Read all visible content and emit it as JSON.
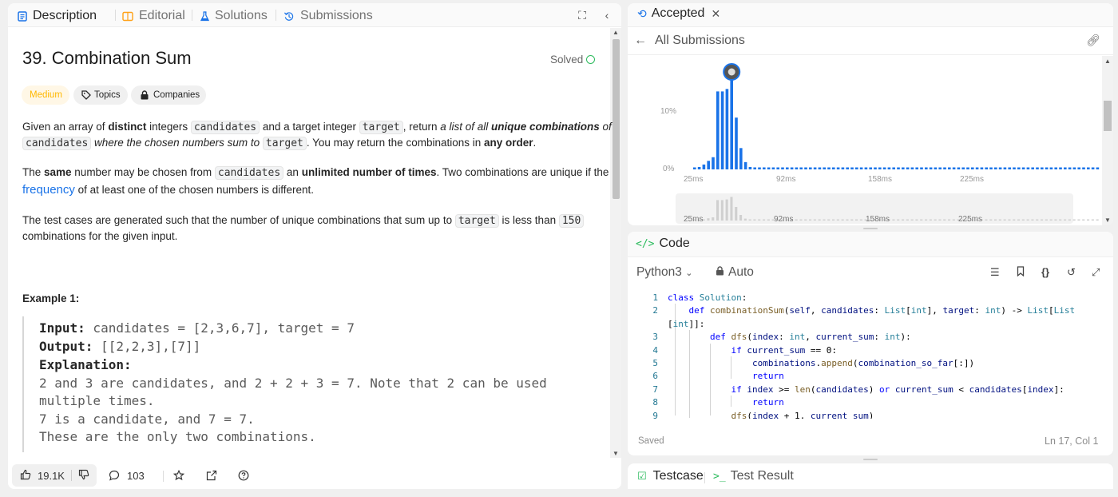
{
  "left_tabs": [
    {
      "label": "Description",
      "icon": "description-icon"
    },
    {
      "label": "Editorial",
      "icon": "editorial-icon"
    },
    {
      "label": "Solutions",
      "icon": "flask-icon"
    },
    {
      "label": "Submissions",
      "icon": "history-icon"
    }
  ],
  "problem": {
    "title": "39. Combination Sum",
    "status": "Solved",
    "difficulty": "Medium",
    "topics_label": "Topics",
    "companies_label": "Companies"
  },
  "description": {
    "p1a": "Given an array of ",
    "p1_distinct": "distinct",
    "p1b": " integers ",
    "p1_code1": "candidates",
    "p1c": " and a target integer ",
    "p1_code2": "target",
    "p1d": ", return ",
    "p1_ital1": "a list of all ",
    "p1_bolditl": "unique combinations",
    "p1_ital2": " of",
    "p2_code": "candidates",
    "p2_ital": " where the chosen numbers sum to ",
    "p2_code2": "target",
    "p2b": ". You may return the combinations in ",
    "p2_bold": "any order",
    "p2c": ".",
    "p3a": "The ",
    "p3_same": "same",
    "p3b": " number may be chosen from ",
    "p3_code": "candidates",
    "p3c": " an ",
    "p3_unl": "unlimited number of times",
    "p3d": ". Two combinations are unique if the",
    "p4_link": "frequency",
    "p4b": " of at least one of the chosen numbers is different.",
    "p5a": "The test cases are generated such that the number of unique combinations that sum up to ",
    "p5_code": "target",
    "p5b": " is less than ",
    "p5_code2": "150",
    "p6": "combinations for the given input."
  },
  "example": {
    "title": "Example 1:",
    "input_label": "Input:",
    "input_value": " candidates = [2,3,6,7], target = 7",
    "output_label": "Output:",
    "output_value": " [[2,2,3],[7]]",
    "explanation_label": "Explanation:",
    "lines": [
      "2 and 3 are candidates, and 2 + 2 + 3 = 7. Note that 2 can be used",
      "multiple times.",
      "7 is a candidate, and 7 = 7.",
      "These are the only two combinations."
    ]
  },
  "bottom_bar": {
    "likes": "19.1K",
    "comments": "103"
  },
  "submission": {
    "tab_label": "Accepted",
    "back_label": "All Submissions"
  },
  "chart_data": {
    "type": "bar",
    "ylabels": [
      "10%",
      "0%"
    ],
    "xticks": [
      "25ms",
      "92ms",
      "158ms",
      "225ms"
    ],
    "values": [
      0.3,
      0.4,
      0.8,
      1.4,
      2.0,
      12.8,
      12.8,
      13.2,
      14.8,
      8.5,
      3.5,
      1.2,
      0.4,
      0.3,
      0.2,
      0.2,
      0.2,
      0.15,
      0.15,
      0.15,
      0.15,
      0.15,
      0.15,
      0.15,
      0.15,
      0.15,
      0.15,
      0.15,
      0.15,
      0.15,
      0.15,
      0.15,
      0.15,
      0.15,
      0.15,
      0.15,
      0.15,
      0.15,
      0.15,
      0.15,
      0.15,
      0.15,
      0.15,
      0.15,
      0.15,
      0.15,
      0.15,
      0.15,
      0.15,
      0.15,
      0.15,
      0.15,
      0.15,
      0.15,
      0.15,
      0.15,
      0.15,
      0.15,
      0.15,
      0.15,
      0.15,
      0.15,
      0.15,
      0.15,
      0.15,
      0.15,
      0.15,
      0.15,
      0.15,
      0.15,
      0.15,
      0.15,
      0.15,
      0.15,
      0.15,
      0.15,
      0.15,
      0.15,
      0.15,
      0.15,
      0.15,
      0.15,
      0.15,
      0.15,
      0.15,
      0.15,
      0.15,
      0.15
    ],
    "highlight_index": 8,
    "ylim": [
      0,
      16
    ],
    "colors": {
      "bar": "#1a73e8",
      "grid": "#e6e6e6",
      "mini_bar": "#d0d0d0"
    }
  },
  "code_panel": {
    "tab_label": "Code",
    "language": "Python3",
    "mode": "Auto",
    "saved": "Saved",
    "position": "Ln 17, Col 1",
    "lines": [
      {
        "n": "1",
        "text": "class Solution:"
      },
      {
        "n": "2",
        "text": "    def combinationSum(self, candidates: List[int], target: int) -> List[List"
      },
      {
        "n": "",
        "text": "[int]]:"
      },
      {
        "n": "3",
        "text": "        def dfs(index: int, current_sum: int):"
      },
      {
        "n": "4",
        "text": "            if current_sum == 0:"
      },
      {
        "n": "5",
        "text": "                combinations.append(combination_so_far[:])"
      },
      {
        "n": "6",
        "text": "                return"
      },
      {
        "n": "7",
        "text": "            if index >= len(candidates) or current_sum < candidates[index]:"
      },
      {
        "n": "8",
        "text": "                return"
      },
      {
        "n": "9",
        "text": "            dfs(index + 1, current_sum)"
      }
    ]
  },
  "testcase": {
    "tab1": "Testcase",
    "tab2": "Test Result"
  }
}
